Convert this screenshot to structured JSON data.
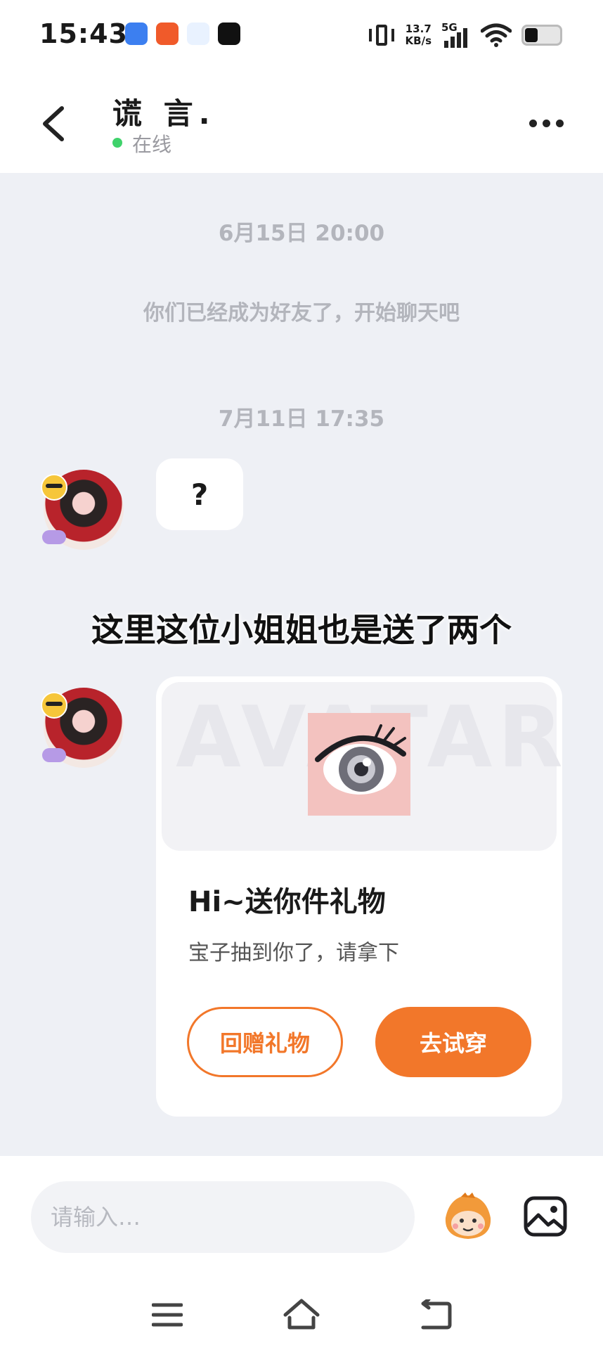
{
  "status_bar": {
    "time": "15:43",
    "net_speed_value": "13.7",
    "net_speed_unit": "KB/s",
    "network_type": "5G",
    "app_icons": [
      "app-icon-blue",
      "app-icon-orange",
      "app-icon-light",
      "app-icon-dark"
    ]
  },
  "header": {
    "contact_name": "谎 言.",
    "status": "在线",
    "status_color": "#3fd26b"
  },
  "chat": {
    "timestamp_1": "6月15日 20:00",
    "system_message": "你们已经成为好友了，开始聊天吧",
    "timestamp_2": "7月11日 17:35",
    "message_1": "?"
  },
  "caption": "这里这位小姐姐也是送了两个",
  "gift_card": {
    "banner_watermark": "AVATAR",
    "title": "Hi~送你件礼物",
    "subtitle": "宝子抽到你了，请拿下",
    "return_button": "回赠礼物",
    "try_button": "去试穿",
    "accent_color": "#f2772a"
  },
  "input": {
    "placeholder": "请输入…"
  }
}
